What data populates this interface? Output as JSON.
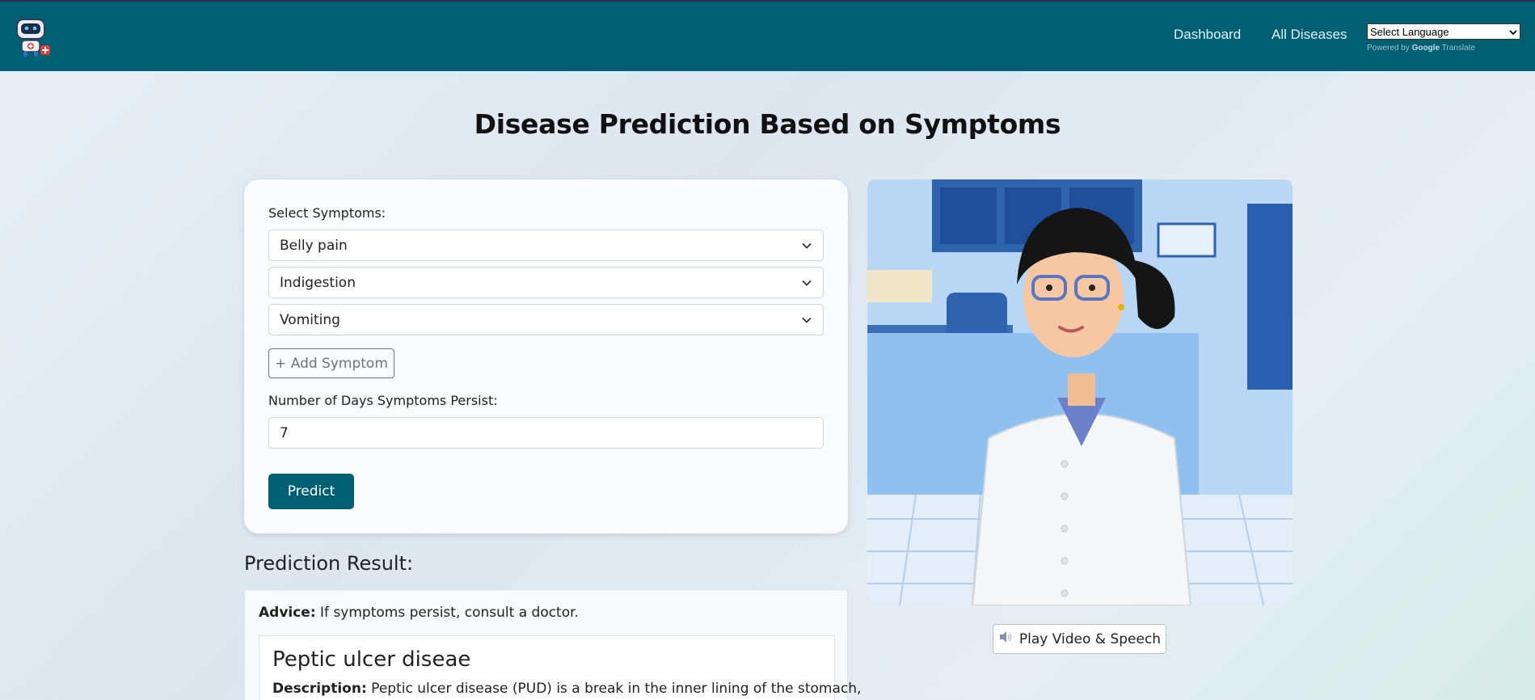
{
  "header": {
    "nav": [
      {
        "label": "Dashboard"
      },
      {
        "label": "All Diseases"
      }
    ],
    "language_select": {
      "value": "Select Language"
    },
    "powered_by": {
      "prefix": "Powered by",
      "brand": "Google",
      "suffix": "Translate"
    }
  },
  "page": {
    "title": "Disease Prediction Based on Symptoms"
  },
  "form": {
    "symptoms_label": "Select Symptoms:",
    "symptoms": [
      "Belly pain",
      "Indigestion",
      "Vomiting"
    ],
    "add_symptom_label": "+ Add Symptom",
    "days_label": "Number of Days Symptoms Persist:",
    "days_value": "7",
    "predict_label": "Predict"
  },
  "result": {
    "title": "Prediction Result:",
    "advice_label": "Advice:",
    "advice_text": "If symptoms persist, consult a doctor.",
    "disease_name": "Peptic ulcer diseae",
    "description_label": "Description:",
    "description_text": "Peptic ulcer disease (PUD) is a break in the inner lining of the stomach,"
  },
  "video": {
    "play_label": "Play Video & Speech"
  },
  "colors": {
    "header_bg": "#005f73",
    "primary_button": "#005f73"
  }
}
